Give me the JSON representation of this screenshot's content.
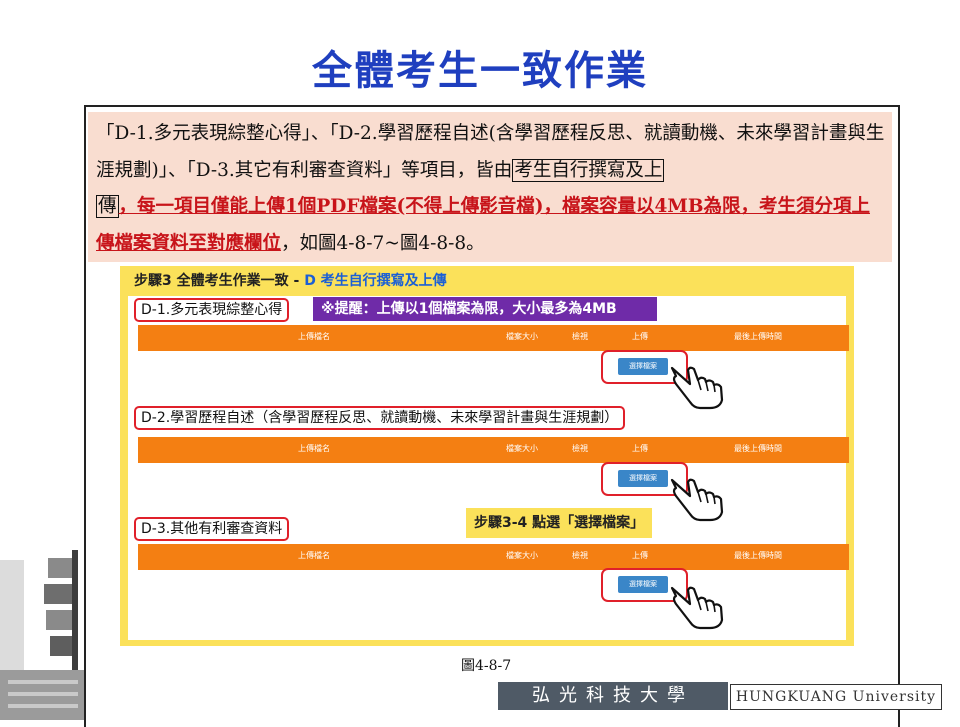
{
  "slide": {
    "title": "全體考生一致作業"
  },
  "paragraph": {
    "t1": "「D-1.多元表現綜整心得」、「D-2.學習歷程自述(含學習歷程反思、就讀動機、未來學習計畫與生涯規劃)」、「D-3.其它有利審查資料」等項目，皆由",
    "boxed1": "考生自行撰寫及上",
    "boxed2": "傳",
    "red": "，每一項目僅能上傳1個PDF檔案(不得上傳影音檔)，檔案容量以4MB為限，考生須分項上傳檔案資料至對應欄位",
    "t2": "，如圖4-8-7~圖4-8-8。"
  },
  "tutorial": {
    "step_title_prefix": "步驟3 全體考生作業一致 - ",
    "step_title_blue": "D 考生自行撰寫及上傳",
    "reminder": "※提醒：上傳以1個檔案為限，大小最多為4MB",
    "sections": [
      {
        "label": "D-1.多元表現綜整心得"
      },
      {
        "label": "D-2.學習歷程自述（含學習歷程反思、就讀動機、未來學習計畫與生涯規劃）"
      },
      {
        "label": "D-3.其他有利審查資料"
      }
    ],
    "columns": {
      "name": "上傳檔名",
      "size": "檔案大小",
      "view": "檢視",
      "upload": "上傳",
      "time": "最後上傳時間"
    },
    "choose_button": "選擇檔案",
    "step34": "步驟3-4 點選「選擇檔案」"
  },
  "caption": "圖4-8-7",
  "footer": {
    "school_zh": "弘光科技大學",
    "school_en": "HUNGKUANG University"
  },
  "colors": {
    "title_blue": "#1f3fbf",
    "orange": "#f47f12",
    "yellow": "#fbe15a",
    "purple": "#6f2ba8",
    "red": "#e0202a",
    "button_blue": "#3a86c8"
  }
}
